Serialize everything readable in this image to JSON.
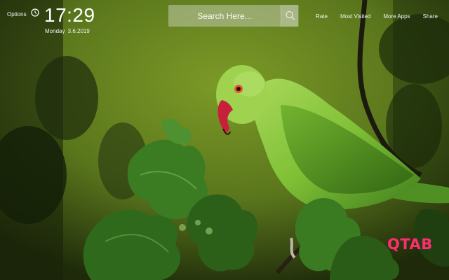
{
  "header": {
    "options_label": "Options",
    "time": "17:29",
    "date": "Monday  3.6.2019"
  },
  "search": {
    "placeholder": "Search Here..."
  },
  "nav": {
    "items": [
      "Rate",
      "Most Visited",
      "More Apps",
      "Share"
    ]
  },
  "brand": {
    "logo_text": "QTAB"
  },
  "icons": {
    "clock": "clock-icon",
    "search": "search-icon"
  },
  "colors": {
    "brand": "#ff2d6f",
    "background": "#5e7a1f",
    "parrot": "#7fbf2e",
    "beak": "#c7203a"
  }
}
